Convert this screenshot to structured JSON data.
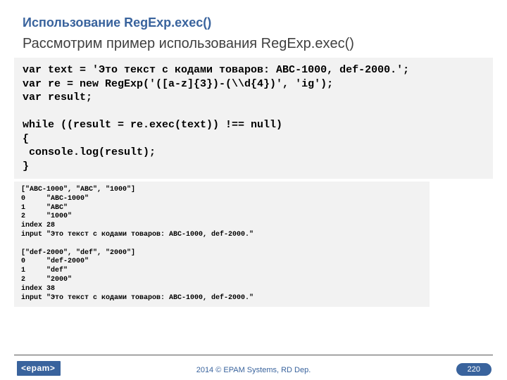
{
  "title": "Использование RegExp.exec()",
  "subtitle": "Рассмотрим пример использования RegExp.exec()",
  "code": "var text = 'Это текст с кодами товаров: ABC-1000, def-2000.';\nvar re = new RegExp('([a-z]{3})-(\\\\d{4})', 'ig');\nvar result;\n\nwhile ((result = re.exec(text)) !== null)\n{\n console.log(result);\n}",
  "output": "[\"ABC-1000\", \"ABC\", \"1000\"]\n0     \"ABC-1000\"\n1     \"ABC\"\n2     \"1000\"\nindex 28\ninput \"Это текст с кодами товаров: ABC-1000, def-2000.\"\n\n[\"def-2000\", \"def\", \"2000\"]\n0     \"def-2000\"\n1     \"def\"\n2     \"2000\"\nindex 38\ninput \"Это текст с кодами товаров: ABC-1000, def-2000.\"",
  "footer": {
    "logo": "<epam>",
    "copyright": "2014 © EPAM Systems, RD Dep.",
    "page": "220"
  }
}
